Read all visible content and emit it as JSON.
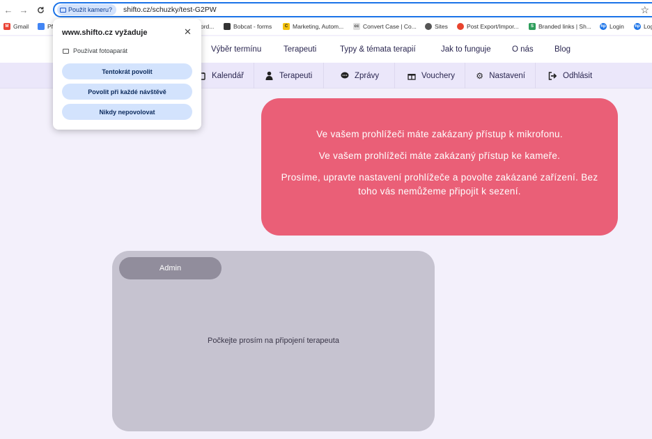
{
  "browser": {
    "back_icon": "←",
    "forward_icon": "→",
    "reload_icon": "C",
    "camera_chip": "Použít kameru?",
    "url": "shifto.cz/schuzky/test-G2PW",
    "star_icon": "☆"
  },
  "bookmarks": [
    {
      "label": "Gmail",
      "icon": "gmail-icon",
      "color": "#ea4335"
    },
    {
      "label": "Pf",
      "icon": "docs-icon",
      "color": "#4285f4"
    },
    {
      "label": "ord...",
      "icon": "bookmark-icon",
      "color": "#888888"
    },
    {
      "label": "Bobcat - forms",
      "icon": "bobcat-icon",
      "color": "#333333"
    },
    {
      "label": "Marketing, Autom...",
      "icon": "marketing-icon",
      "color": "#f4c20d"
    },
    {
      "label": "Convert Case | Co...",
      "icon": "convertcase-icon",
      "color": "#666666"
    },
    {
      "label": "Sites",
      "icon": "sites-icon",
      "color": "#555555"
    },
    {
      "label": "Post Export/Impor...",
      "icon": "post-export-icon",
      "color": "#e8442e"
    },
    {
      "label": "Branded links | Sh...",
      "icon": "branded-links-icon",
      "color": "#2e9e5b"
    },
    {
      "label": "Login",
      "icon": "hp-icon",
      "color": "#1a73e8"
    },
    {
      "label": "Log",
      "icon": "hp-icon",
      "color": "#1a73e8"
    }
  ],
  "main_nav": [
    "Výběr termínu",
    "Terapeuti",
    "Typy & témata terapií",
    "Jak to funguje",
    "O nás",
    "Blog"
  ],
  "sub_nav": [
    {
      "label": "Kalendář",
      "icon": "calendar-icon"
    },
    {
      "label": "Terapeuti",
      "icon": "person-icon"
    },
    {
      "label": "Zprávy",
      "icon": "chat-icon"
    },
    {
      "label": "Vouchery",
      "icon": "gift-icon"
    },
    {
      "label": "Nastavení",
      "icon": "gear-icon"
    },
    {
      "label": "Odhlásit",
      "icon": "logout-icon"
    }
  ],
  "alert": {
    "mic_message": "Ve vašem prohlížeči máte zakázaný přístup k mikrofonu.",
    "cam_message": "Ve vašem prohlížeči máte zakázaný přístup ke kameře.",
    "instruction": "Prosíme, upravte nastavení prohlížeče a povolte zakázané zařízení. Bez toho vás nemůžeme připojit k sezení."
  },
  "video_panel": {
    "participant": "Admin",
    "waiting_text": "Počkejte prosím na připojení terapeuta"
  },
  "permission_popup": {
    "title": "www.shifto.cz vyžaduje",
    "close_icon": "✕",
    "permission": "Používat fotoaparát",
    "allow_once": "Tentokrát povolit",
    "allow_always": "Povolit při každé návštěvě",
    "never_allow": "Nikdy nepovolovat"
  },
  "colors": {
    "alert_bg": "#ea5f77",
    "page_bg": "#f3f0fb",
    "subnav_bg": "#ebe7fa",
    "video_bg": "#c6c3d0",
    "chip_bg": "#d3e3fd",
    "focus_blue": "#1a73e8"
  }
}
